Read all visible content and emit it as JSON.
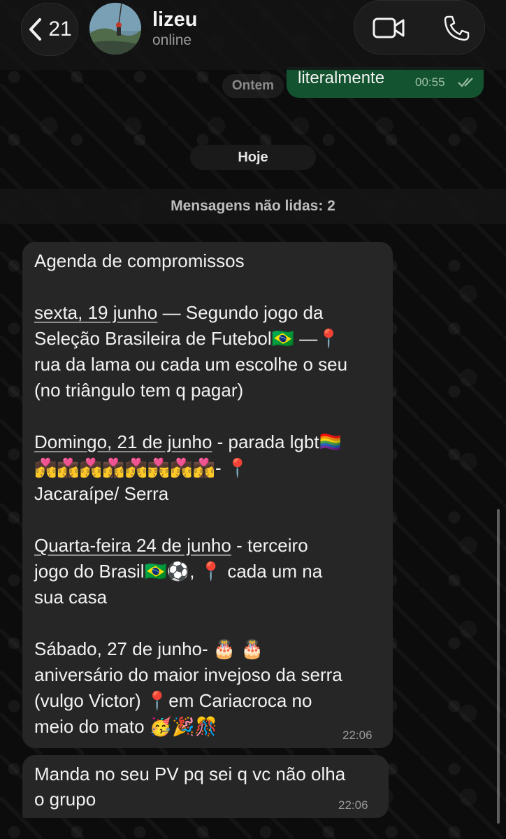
{
  "header": {
    "back_count": "21",
    "contact_name": "lizeu",
    "contact_status": "online"
  },
  "outgoing": {
    "text": "literalmente",
    "time": "00:55"
  },
  "date_pills": {
    "yesterday": "Ontem",
    "today": "Hoje"
  },
  "unread_banner": "Mensagens não lidas: 2",
  "message1": {
    "title": "Agenda de compromissos",
    "item1": {
      "date": "sexta, 19 junho",
      "line1": " — Segundo jogo da",
      "line2": "Seleção Brasileira de Futebol🇧🇷 —📍",
      "line3": "rua da  lama ou cada um escolhe o seu",
      "line4": "(no triângulo tem q pagar)"
    },
    "item2": {
      "date": "Domingo, 21 de junho",
      "line1": " - parada lgbt🏳️‍🌈",
      "line2": "💏👩‍❤️‍💋‍👩💏👩‍❤️‍💋‍👩💏👨‍❤️‍💋‍👨💏👩‍❤️‍💋‍👩- 📍",
      "line3": "Jacaraípe/ Serra"
    },
    "item3": {
      "date": "Quarta-feira 24 de junho",
      "line1": " - terceiro",
      "line2": "jogo do Brasil🇧🇷⚽, 📍 cada um na",
      "line3": "sua casa"
    },
    "item4": {
      "line1": "Sábado, 27 de junho- 🎂 🎂",
      "line2": "aniversário do maior invejoso da serra",
      "line3": "(vulgo Victor) 📍em Cariacroca no",
      "line4": "meio do mato 🥳🎉🎊"
    },
    "time": "22:06"
  },
  "message2": {
    "line1": "Manda no seu PV pq sei q vc não olha",
    "line2": "o grupo",
    "time": "22:06"
  },
  "colors": {
    "outgoing_bubble": "#14532f",
    "incoming_bubble": "#262626",
    "background": "#0c0c0c"
  }
}
